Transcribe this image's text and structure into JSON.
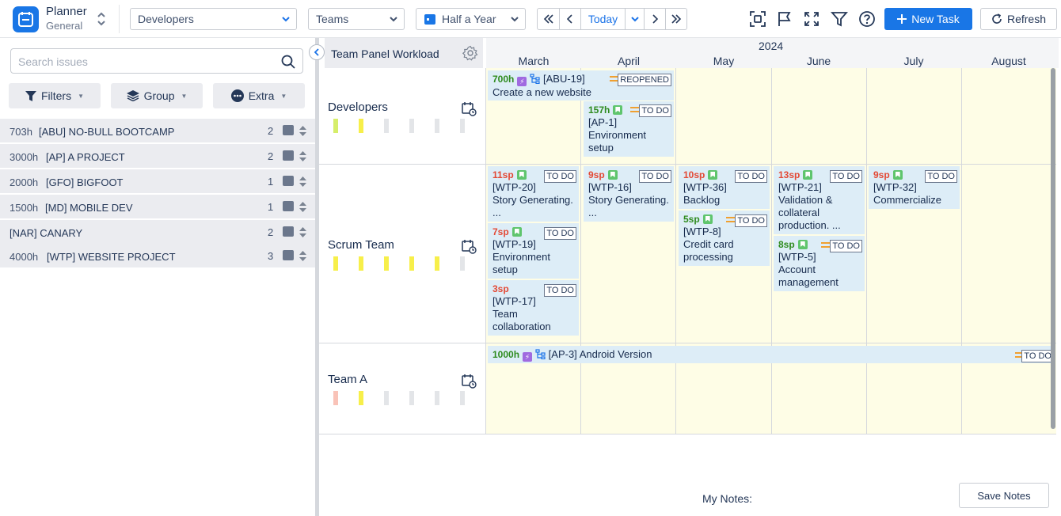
{
  "app": {
    "name": "Planner",
    "subtitle": "General"
  },
  "toolbar": {
    "board_select": "Developers",
    "group_select": "Teams",
    "range_select": "Half a Year",
    "today_label": "Today",
    "new_task_label": "New Task",
    "refresh_label": "Refresh",
    "icons": [
      "screenshot-icon",
      "flag-icon",
      "fullscreen-icon",
      "filter-icon",
      "help-icon"
    ]
  },
  "sidebar": {
    "search_placeholder": "Search issues",
    "filters_label": "Filters",
    "group_label": "Group",
    "extra_label": "Extra",
    "projects": [
      {
        "hours": "703h",
        "name": "[ABU] NO-BULL BOOTCAMP",
        "count": "2"
      },
      {
        "hours": "3000h",
        "name": "[AP] A PROJECT",
        "count": "2"
      },
      {
        "hours": "2000h",
        "name": "[GFO] BIGFOOT",
        "count": "1"
      },
      {
        "hours": "1500h",
        "name": "[MD] MOBILE DEV",
        "count": "1"
      },
      {
        "hours": "",
        "name": "[NAR] CANARY",
        "count": "2"
      },
      {
        "hours": "4000h",
        "name": "[WTP] WEBSITE PROJECT",
        "count": "3"
      }
    ]
  },
  "board": {
    "panel_title": "Team Panel Workload",
    "year": "2024",
    "months": [
      "March",
      "April",
      "May",
      "June",
      "July",
      "August"
    ],
    "rows": [
      {
        "name": "Developers",
        "workload": [
          "#d6ee6a",
          "#f7ef4a",
          "#e3e5e8",
          "#e3e5e8",
          "#e3e5e8",
          "#e3e5e8"
        ]
      },
      {
        "name": "Scrum Team",
        "workload": [
          "#f7ef4a",
          "#f7ef4a",
          "#f7ef4a",
          "#f7ef4a",
          "#f7ef4a",
          "#e3e5e8"
        ]
      },
      {
        "name": "Team A",
        "workload": [
          "#f9c3b8",
          "#f7ef4a",
          "#e3e5e8",
          "#e3e5e8",
          "#e3e5e8",
          "#e3e5e8"
        ]
      }
    ],
    "cards": {
      "abu19": {
        "pts": "700h",
        "key": "[ABU-19]",
        "title": "Create a new website",
        "status": "REOPENED"
      },
      "ap1": {
        "pts": "157h",
        "key": "[AP-1]",
        "title": "Environment setup",
        "status": "TO DO"
      },
      "wtp20": {
        "pts": "11sp",
        "key": "[WTP-20]",
        "title": "Story Generating. ...",
        "status": "TO DO"
      },
      "wtp19": {
        "pts": "7sp",
        "key": "[WTP-19]",
        "title": "Environment setup",
        "status": "TO DO"
      },
      "wtp17": {
        "pts": "3sp",
        "key": "[WTP-17]",
        "title": "Team collaboration",
        "status": "TO DO"
      },
      "wtp16": {
        "pts": "9sp",
        "key": "[WTP-16]",
        "title": "Story Generating. ...",
        "status": "TO DO"
      },
      "wtp36": {
        "pts": "10sp",
        "key": "[WTP-36]",
        "title": "Backlog",
        "status": "TO DO"
      },
      "wtp8": {
        "pts": "5sp",
        "key": "[WTP-8]",
        "title": "Credit card processing",
        "status": "TO DO"
      },
      "wtp21": {
        "pts": "13sp",
        "key": "[WTP-21]",
        "title": "Validation & collateral production. ...",
        "status": "TO DO"
      },
      "wtp5": {
        "pts": "8sp",
        "key": "[WTP-5]",
        "title": "Account management",
        "status": "TO DO"
      },
      "wtp32": {
        "pts": "9sp",
        "key": "[WTP-32]",
        "title": "Commercialize",
        "status": "TO DO"
      },
      "ap3": {
        "pts": "1000h",
        "key": "[AP-3]",
        "title": "Android Version",
        "status": "TO DO"
      }
    }
  },
  "notes": {
    "label": "My Notes:",
    "save_label": "Save Notes"
  }
}
